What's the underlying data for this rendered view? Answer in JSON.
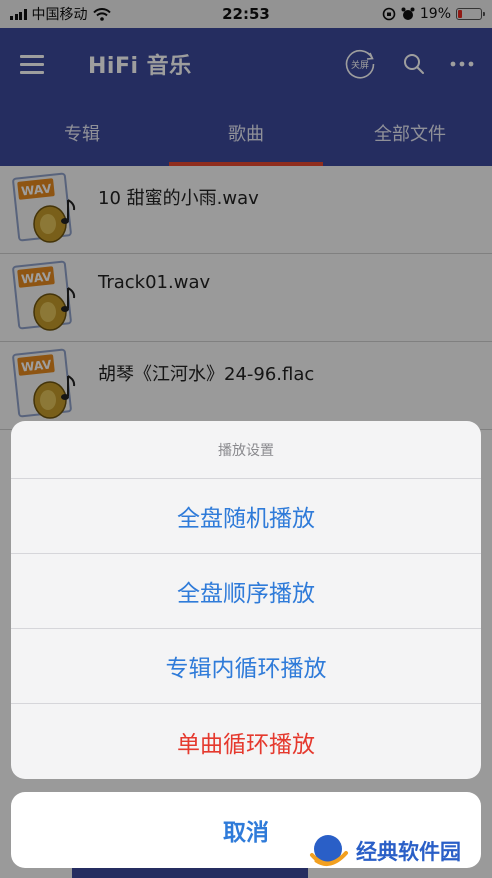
{
  "status_bar": {
    "carrier": "中国移动",
    "time": "22:53",
    "battery_text": "19%",
    "battery_level": 0.19
  },
  "app_bar": {
    "title": "HiFi 音乐",
    "timer_badge": "关屏"
  },
  "tabs": [
    {
      "label": "专辑",
      "active": false
    },
    {
      "label": "歌曲",
      "active": true
    },
    {
      "label": "全部文件",
      "active": false
    }
  ],
  "tracks": [
    {
      "name": "10 甜蜜的小雨.wav",
      "badge": "WAV"
    },
    {
      "name": "Track01.wav",
      "badge": "WAV"
    },
    {
      "name": "胡琴《江河水》24-96.flac",
      "badge": "WAV"
    }
  ],
  "action_sheet": {
    "title": "播放设置",
    "options": [
      {
        "label": "全盘随机播放"
      },
      {
        "label": "全盘顺序播放"
      },
      {
        "label": "专辑内循环播放"
      },
      {
        "label": "单曲循环播放"
      }
    ],
    "cancel": "取消"
  },
  "watermark": {
    "text": "经典软件园"
  },
  "colors": {
    "primary": "#3d499c",
    "tab_indicator": "#e94a2f",
    "action_blue": "#2f7bd9",
    "action_red": "#e5392e"
  }
}
